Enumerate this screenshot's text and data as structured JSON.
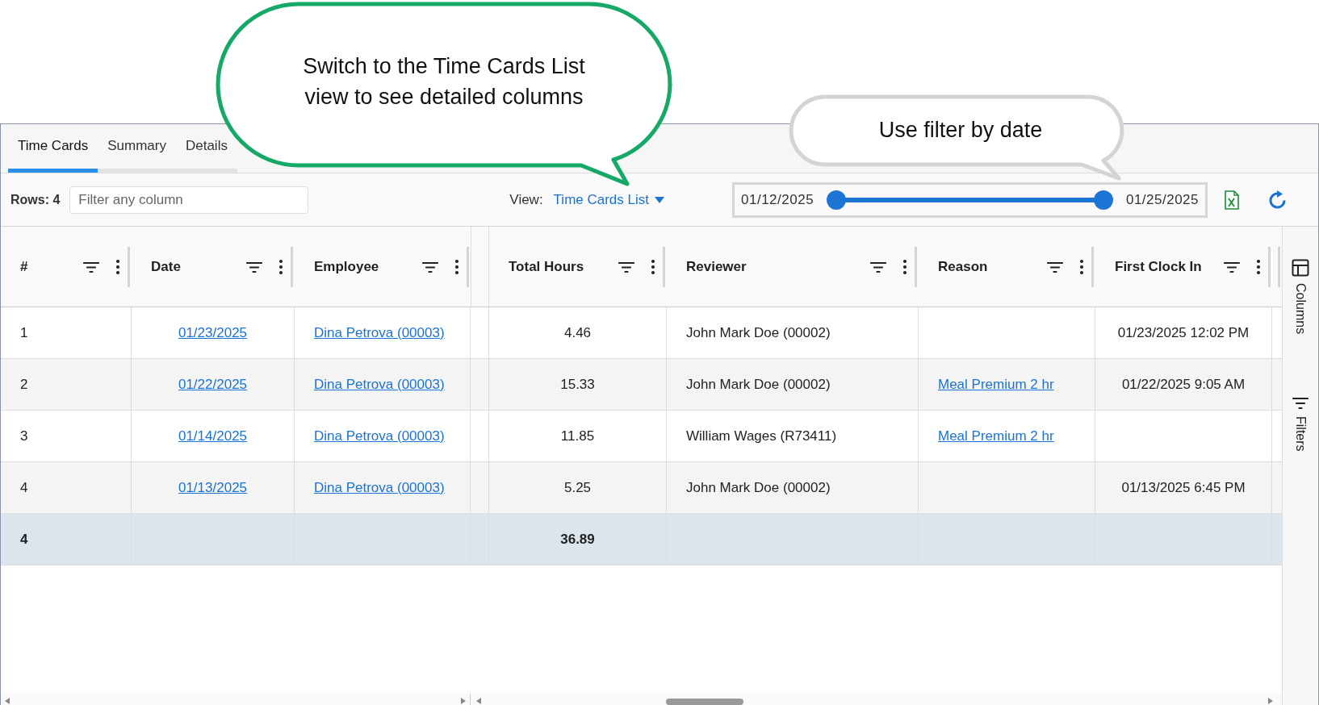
{
  "callouts": [
    {
      "text": "Switch to the Time Cards List view to see detailed columns",
      "color": "#15a866"
    },
    {
      "text": "Use filter by date",
      "color": "#d4d4d4"
    }
  ],
  "tabs": [
    {
      "label": "Time Cards",
      "selected": true
    },
    {
      "label": "Summary",
      "selected": false
    },
    {
      "label": "Details",
      "selected": false
    }
  ],
  "toolbar": {
    "rows_label": "Rows: 4",
    "filter": {
      "placeholder": "Filter any column"
    },
    "view_label": "View:",
    "view_value": "Time Cards List",
    "date_range": {
      "start": "01/12/2025",
      "end": "01/25/2025",
      "thumbs": [
        {
          "level": 0
        },
        {
          "level": 1
        }
      ]
    }
  },
  "table": {
    "columns": [
      {
        "label": "#"
      },
      {
        "label": "Date"
      },
      {
        "label": "Employee"
      },
      {
        "label": "Total Hours"
      },
      {
        "label": "Reviewer"
      },
      {
        "label": "Reason"
      },
      {
        "label": "First Clock In"
      }
    ],
    "rows": [
      {
        "cells": [
          {
            "kind": "text",
            "text": "1"
          },
          {
            "kind": "link",
            "text": "01/23/2025"
          },
          {
            "kind": "link",
            "text": "Dina Petrova (00003)"
          },
          {
            "kind": "text",
            "text": "4.46"
          },
          {
            "kind": "text",
            "text": "John Mark Doe (00002)"
          },
          {
            "kind": "empty"
          },
          {
            "kind": "text",
            "text": "01/23/2025 12:02 PM"
          }
        ]
      },
      {
        "cells": [
          {
            "kind": "text",
            "text": "2"
          },
          {
            "kind": "link",
            "text": "01/22/2025"
          },
          {
            "kind": "link",
            "text": "Dina Petrova (00003)"
          },
          {
            "kind": "text",
            "text": "15.33"
          },
          {
            "kind": "text",
            "text": "John Mark Doe (00002)"
          },
          {
            "kind": "link",
            "text": "Meal Premium 2 hr"
          },
          {
            "kind": "text",
            "text": "01/22/2025 9:05 AM"
          }
        ]
      },
      {
        "cells": [
          {
            "kind": "text",
            "text": "3"
          },
          {
            "kind": "link",
            "text": "01/14/2025"
          },
          {
            "kind": "link",
            "text": "Dina Petrova (00003)"
          },
          {
            "kind": "text",
            "text": "11.85"
          },
          {
            "kind": "text",
            "text": "William Wages (R73411)"
          },
          {
            "kind": "link",
            "text": "Meal Premium 2 hr"
          },
          {
            "kind": "empty"
          }
        ]
      },
      {
        "cells": [
          {
            "kind": "text",
            "text": "4"
          },
          {
            "kind": "link",
            "text": "01/13/2025"
          },
          {
            "kind": "link",
            "text": "Dina Petrova (00003)"
          },
          {
            "kind": "text",
            "text": "5.25"
          },
          {
            "kind": "text",
            "text": "John Mark Doe (00002)"
          },
          {
            "kind": "empty"
          },
          {
            "kind": "text",
            "text": "01/13/2025 6:45 PM"
          }
        ]
      }
    ],
    "totals": [
      {
        "kind": "text",
        "text": "4"
      },
      {
        "kind": "empty"
      },
      {
        "kind": "empty"
      },
      {
        "kind": "text",
        "text": "36.89"
      },
      {
        "kind": "empty"
      },
      {
        "kind": "empty"
      },
      {
        "kind": "empty"
      }
    ]
  },
  "side_panel": [
    {
      "label": "Columns",
      "kind": "columns"
    },
    {
      "label": "Filters",
      "kind": "filters"
    }
  ]
}
